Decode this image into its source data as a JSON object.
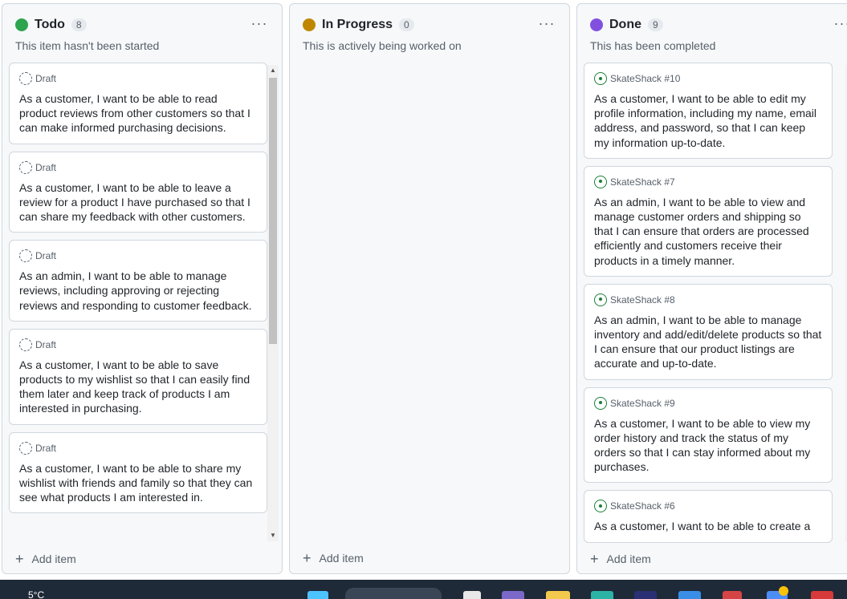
{
  "columns": [
    {
      "id": "todo",
      "title": "Todo",
      "count": "8",
      "description": "This item hasn't been started",
      "color": "#2da44e",
      "menu_label": "···",
      "add_label": "Add item",
      "cards": [
        {
          "meta": "Draft",
          "text": "As a customer, I want to be able to read product reviews from other customers so that I can make informed purchasing decisions."
        },
        {
          "meta": "Draft",
          "text": "As a customer, I want to be able to leave a review for a product I have purchased so that I can share my feedback with other customers."
        },
        {
          "meta": "Draft",
          "text": "As an admin, I want to be able to manage reviews, including approving or rejecting reviews and responding to customer feedback."
        },
        {
          "meta": "Draft",
          "text": "As a customer, I want to be able to save products to my wishlist so that I can easily find them later and keep track of products I am interested in purchasing."
        },
        {
          "meta": "Draft",
          "text": "As a customer, I want to be able to share my wishlist with friends and family so that they can see what products I am interested in."
        }
      ]
    },
    {
      "id": "in-progress",
      "title": "In Progress",
      "count": "0",
      "description": "This is actively being worked on",
      "color": "#bf8700",
      "menu_label": "···",
      "add_label": "Add item",
      "cards": []
    },
    {
      "id": "done",
      "title": "Done",
      "count": "9",
      "description": "This has been completed",
      "color": "#8250df",
      "menu_label": "···",
      "add_label": "Add item",
      "cards": [
        {
          "meta": "SkateShack #10",
          "text": "As a customer, I want to be able to edit my profile information, including my name, email address, and password, so that I can keep my information up-to-date."
        },
        {
          "meta": "SkateShack #7",
          "text": "As an admin, I want to be able to view and manage customer orders and shipping so that I can ensure that orders are processed efficiently and customers receive their products in a timely manner."
        },
        {
          "meta": "SkateShack #8",
          "text": "As an admin, I want to be able to manage inventory and add/edit/delete products so that I can ensure that our product listings are accurate and up-to-date."
        },
        {
          "meta": "SkateShack #9",
          "text": "As a customer, I want to be able to view my order history and track the status of my orders so that I can stay informed about my purchases."
        },
        {
          "meta": "SkateShack #6",
          "text": "As a customer, I want to be able to create a"
        }
      ]
    }
  ],
  "taskbar": {
    "weather": "5°C"
  }
}
